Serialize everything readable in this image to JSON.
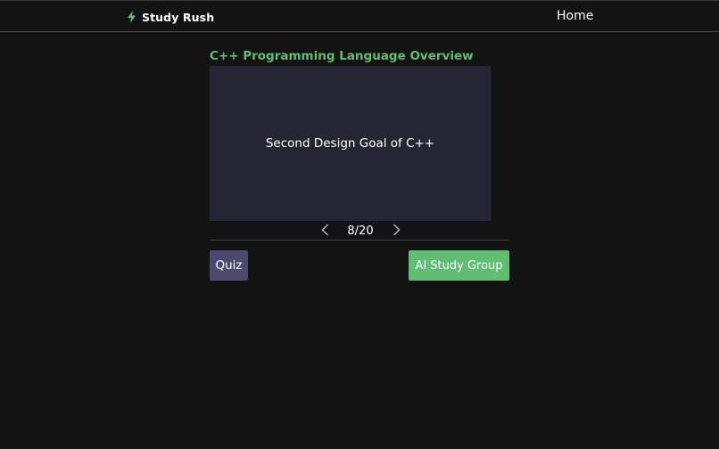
{
  "navbar": {
    "brand_icon": "bolt-icon",
    "brand_name": "Study Rush",
    "home_label": "Home"
  },
  "deck": {
    "title": "C++ Programming Language Overview",
    "card_text": "Second Design Goal of C++",
    "pager": {
      "prev_icon": "chevron-left-icon",
      "next_icon": "chevron-right-icon",
      "count_text": "8/20",
      "current": 8,
      "total": 20
    }
  },
  "actions": {
    "quiz_label": "Quiz",
    "ai_study_group_label": "AI Study Group"
  },
  "colors": {
    "background": "#131313",
    "accent_green": "#5fbe72",
    "card_bg": "#262534",
    "quiz_button_bg": "#4b4a6e"
  }
}
